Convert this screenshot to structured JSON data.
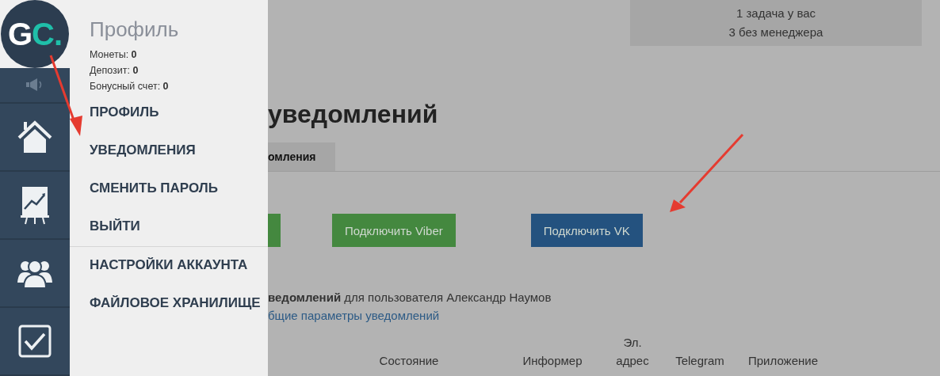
{
  "logo": {
    "primary": "G",
    "accent": "C."
  },
  "sidebar": {
    "items": [
      {
        "kind": "speaker"
      },
      {
        "kind": "home"
      },
      {
        "kind": "chart"
      },
      {
        "kind": "people"
      },
      {
        "kind": "check"
      }
    ]
  },
  "profile_menu": {
    "title": "Профиль",
    "stats": [
      "Монеты: **0**",
      "Депозит: **0**",
      "Бонусный счет: **0**"
    ],
    "items": [
      "ПРОФИЛЬ",
      "УВЕДОМЛЕНИЯ",
      "СМЕНИТЬ ПАРОЛЬ",
      "ВЫЙТИ"
    ],
    "account_items": [
      "НАСТРОЙКИ АККАУНТА",
      "ФАЙЛОВОЕ ХРАНИЛИЩЕ"
    ]
  },
  "tasks": [
    "1 задача у вас",
    "3 без менеджера"
  ],
  "heading": "уведомлений",
  "tabs": [
    {
      "label": "омления",
      "selected": true
    }
  ],
  "buttons": [
    {
      "color": "#44883f"
    },
    {
      "label": "Подключить Viber",
      "color": "#44883f"
    },
    {
      "label": "Подключить VK",
      "color": "#24527f"
    }
  ],
  "description": "**ведомлений** для пользователя Александр Наумов",
  "link": "бщие параметры уведомлений",
  "table": {
    "columns": [
      "Состояние",
      "Информер",
      "Эл. адрес",
      "Telegram",
      "Приложение"
    ]
  }
}
